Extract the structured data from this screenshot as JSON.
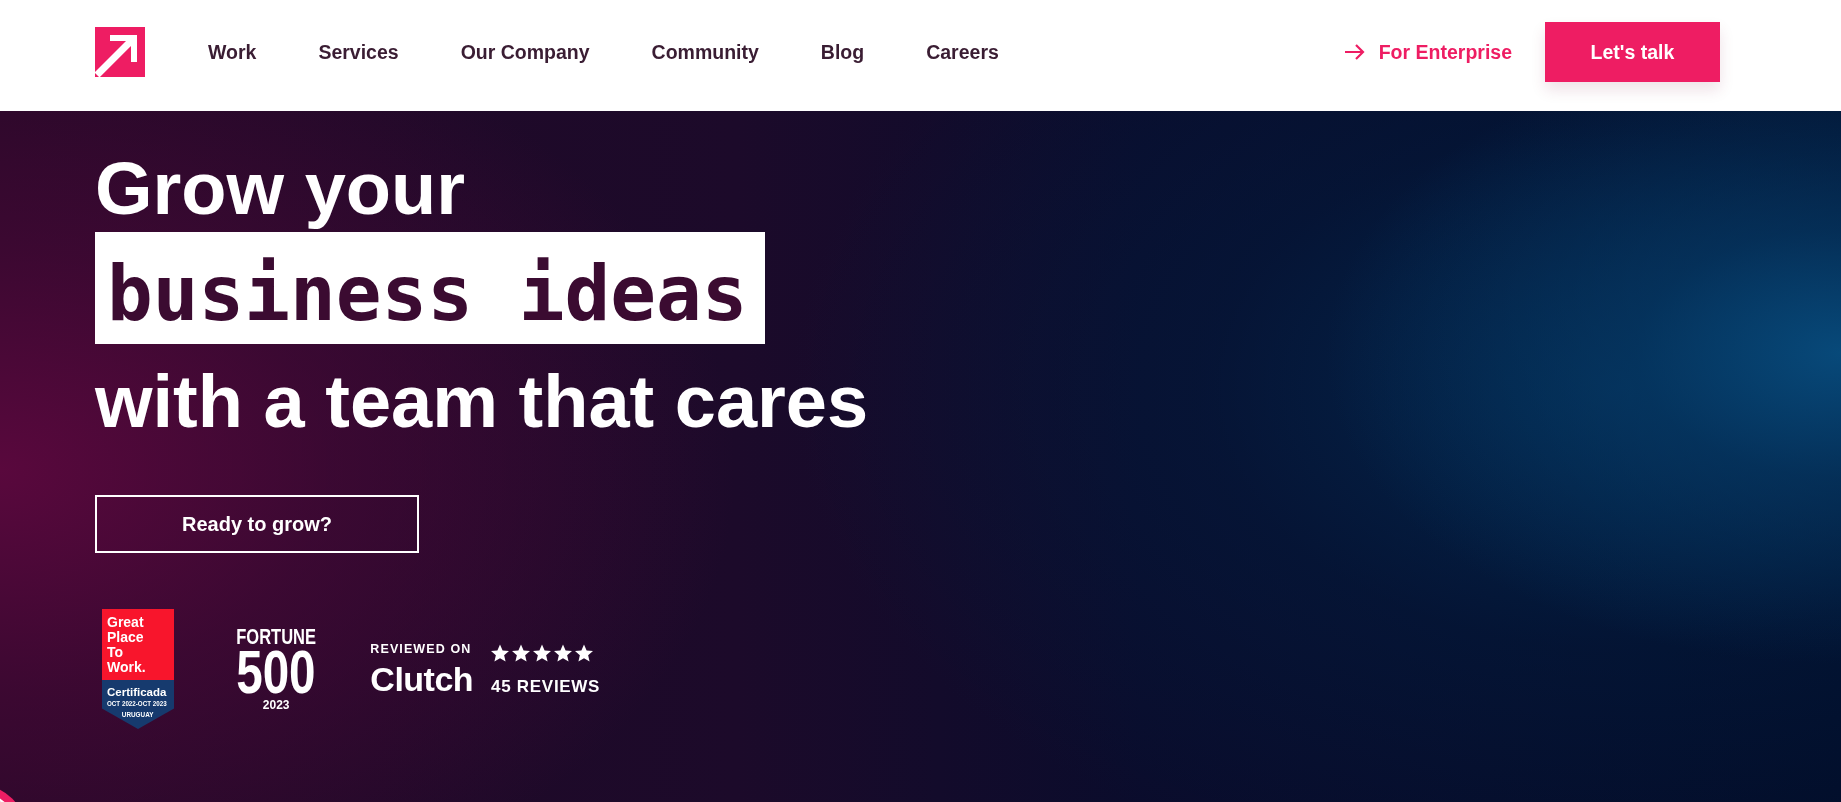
{
  "header": {
    "nav": [
      "Work",
      "Services",
      "Our Company",
      "Community",
      "Blog",
      "Careers"
    ],
    "enterprise_link": "For Enterprise",
    "cta_button": "Let's talk"
  },
  "hero": {
    "headline_top": "Grow your",
    "headline_highlight": "business ideas",
    "headline_bottom": "with a team that cares",
    "button": "Ready to grow?"
  },
  "awards": {
    "great_place_to_work": {
      "title": "Great Place To Work.",
      "label": "Certificada",
      "period": "OCT 2022-OCT 2023",
      "country": "URUGUAY"
    },
    "fortune": {
      "name": "FORTUNE",
      "number": "500",
      "year": "2023"
    },
    "clutch": {
      "caption": "REVIEWED ON",
      "name": "Clutch",
      "stars": 5,
      "reviews": "45 REVIEWS"
    }
  }
}
